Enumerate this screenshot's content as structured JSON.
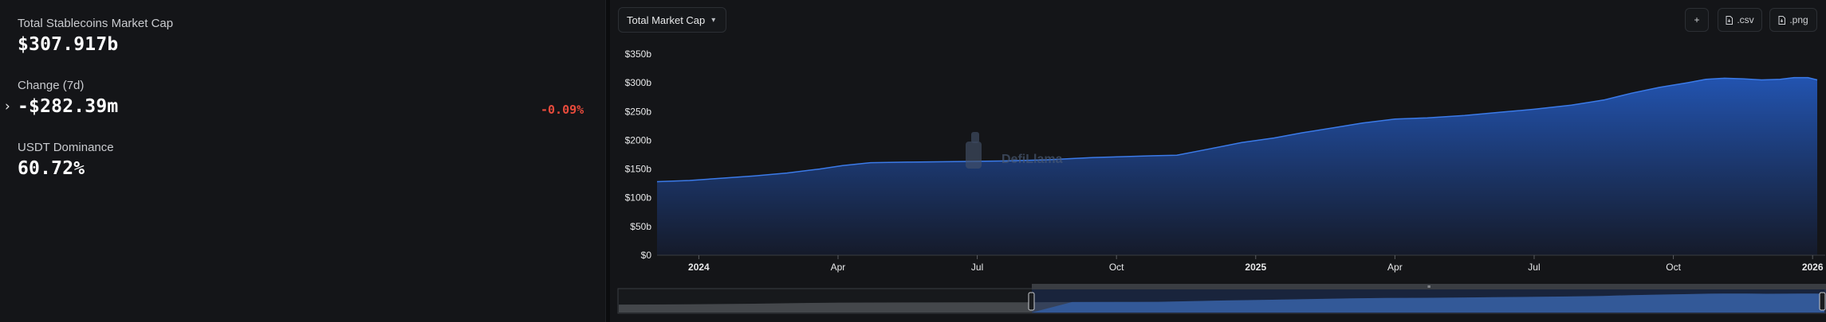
{
  "stats": {
    "market_cap_label": "Total Stablecoins Market Cap",
    "market_cap_value": "$307.917b",
    "change_label": "Change (7d)",
    "change_value": "-$282.39m",
    "change_pct": "-0.09%",
    "dominance_label": "USDT Dominance",
    "dominance_value": "60.72%"
  },
  "toolbar": {
    "metric_select": "Total Market Cap",
    "add_label": "+",
    "csv_label": ".csv",
    "png_label": ".png"
  },
  "watermark": "DefiLlama",
  "colors": {
    "accent": "#2f6fd6",
    "negative": "#e84b3c",
    "background": "#141518"
  },
  "chart_data": {
    "type": "area",
    "title": "",
    "xlabel": "",
    "ylabel": "",
    "ylim": [
      0,
      350
    ],
    "y_unit": "b",
    "y_ticks": [
      "$0",
      "$50b",
      "$100b",
      "$150b",
      "$200b",
      "$250b",
      "$300b",
      "$350b"
    ],
    "x_ticks": [
      {
        "label": "2024",
        "t": 0.5,
        "bold": true
      },
      {
        "label": "Apr",
        "t": 3.5,
        "bold": false
      },
      {
        "label": "Jul",
        "t": 6.5,
        "bold": false
      },
      {
        "label": "Oct",
        "t": 9.5,
        "bold": false
      },
      {
        "label": "2025",
        "t": 12.5,
        "bold": true
      },
      {
        "label": "Apr",
        "t": 15.5,
        "bold": false
      },
      {
        "label": "Jul",
        "t": 18.5,
        "bold": false
      },
      {
        "label": "Oct",
        "t": 21.5,
        "bold": false
      },
      {
        "label": "2026",
        "t": 24.5,
        "bold": true
      }
    ],
    "x_range": [
      -0.4,
      24.6
    ],
    "series": [
      {
        "x": [
          -0.4,
          0.3,
          1,
          1.7,
          2.4,
          3.1,
          3.6,
          4.2,
          5,
          6,
          7,
          8,
          9,
          10.3,
          10.8,
          11.5,
          12.2,
          12.9,
          13.5,
          14.2,
          14.8,
          15.5,
          16.2,
          17,
          17.8,
          18.5,
          19.3,
          20,
          20.6,
          21.2,
          21.8,
          22.2,
          22.6,
          23,
          23.4,
          23.8,
          24.1,
          24.4,
          24.6
        ],
        "values": [
          128,
          130,
          134,
          138,
          143,
          150,
          156,
          161,
          162,
          163,
          164,
          166,
          170,
          173,
          174,
          185,
          196,
          204,
          213,
          222,
          230,
          237,
          239,
          243,
          249,
          254,
          261,
          270,
          282,
          292,
          300,
          306,
          308,
          307,
          305,
          306,
          309,
          309,
          305
        ]
      }
    ]
  }
}
